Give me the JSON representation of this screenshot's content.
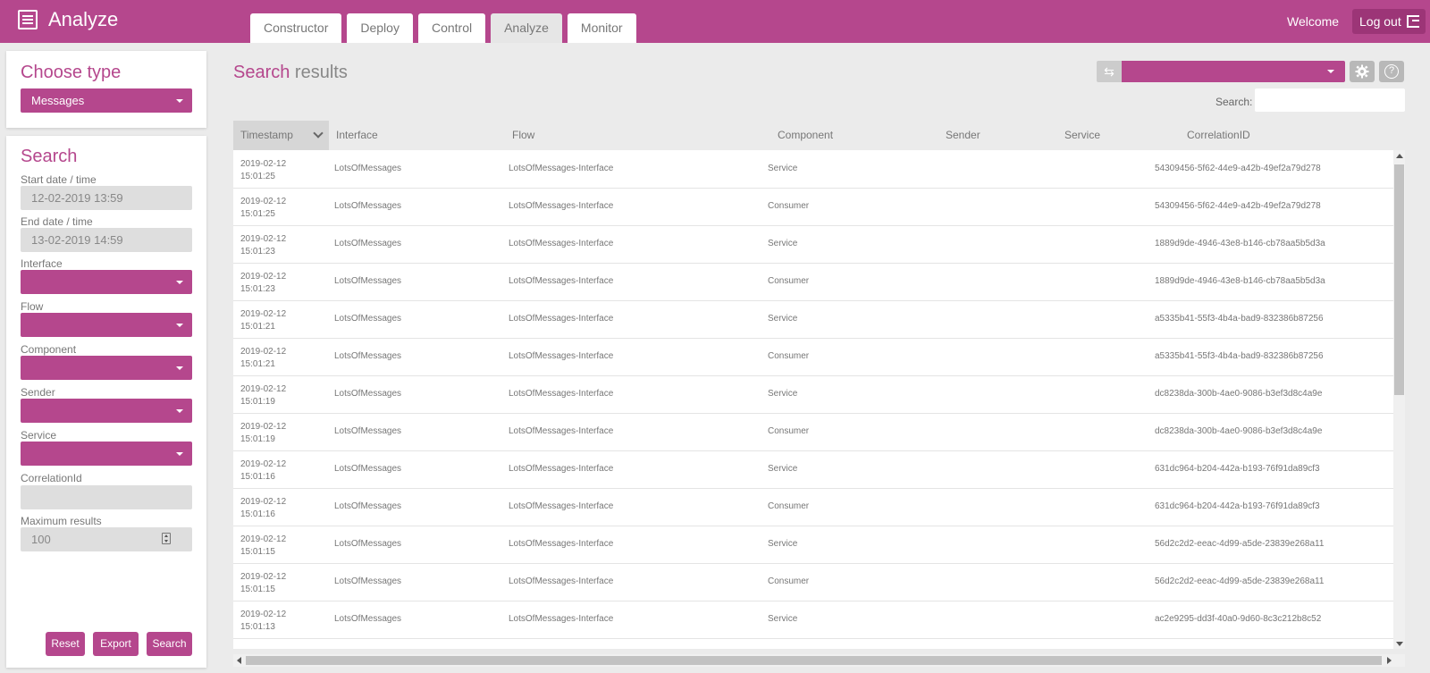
{
  "app": {
    "title": "Analyze",
    "welcome": "Welcome",
    "logout_label": "Log out"
  },
  "tabs": [
    {
      "label": "Constructor",
      "active": false
    },
    {
      "label": "Deploy",
      "active": false
    },
    {
      "label": "Control",
      "active": false
    },
    {
      "label": "Analyze",
      "active": true
    },
    {
      "label": "Monitor",
      "active": false
    }
  ],
  "choose_type": {
    "title": "Choose type",
    "selected": "Messages"
  },
  "search_panel": {
    "title": "Search",
    "start_label": "Start date / time",
    "start_value": "12-02-2019 13:59",
    "end_label": "End date / time",
    "end_value": "13-02-2019 14:59",
    "interface_label": "Interface",
    "flow_label": "Flow",
    "component_label": "Component",
    "sender_label": "Sender",
    "service_label": "Service",
    "correlation_label": "CorrelationId",
    "correlation_value": "",
    "max_label": "Maximum results",
    "max_value": "100",
    "reset_label": "Reset",
    "export_label": "Export",
    "search_label": "Search"
  },
  "results": {
    "title_accent": "Search",
    "title_rest": " results",
    "search_label": "Search:",
    "search_value": ""
  },
  "table": {
    "columns": [
      "Timestamp",
      "Interface",
      "Flow",
      "Component",
      "Sender",
      "Service",
      "CorrelationID"
    ],
    "rows": [
      {
        "date": "2019-02-12",
        "time": "15:01:25",
        "interface": "LotsOfMessages",
        "flow": "LotsOfMessages-Interface",
        "component": "Service",
        "sender": "",
        "service": "",
        "correlation": "54309456-5f62-44e9-a42b-49ef2a79d278"
      },
      {
        "date": "2019-02-12",
        "time": "15:01:25",
        "interface": "LotsOfMessages",
        "flow": "LotsOfMessages-Interface",
        "component": "Consumer",
        "sender": "",
        "service": "",
        "correlation": "54309456-5f62-44e9-a42b-49ef2a79d278"
      },
      {
        "date": "2019-02-12",
        "time": "15:01:23",
        "interface": "LotsOfMessages",
        "flow": "LotsOfMessages-Interface",
        "component": "Service",
        "sender": "",
        "service": "",
        "correlation": "1889d9de-4946-43e8-b146-cb78aa5b5d3a"
      },
      {
        "date": "2019-02-12",
        "time": "15:01:23",
        "interface": "LotsOfMessages",
        "flow": "LotsOfMessages-Interface",
        "component": "Consumer",
        "sender": "",
        "service": "",
        "correlation": "1889d9de-4946-43e8-b146-cb78aa5b5d3a"
      },
      {
        "date": "2019-02-12",
        "time": "15:01:21",
        "interface": "LotsOfMessages",
        "flow": "LotsOfMessages-Interface",
        "component": "Service",
        "sender": "",
        "service": "",
        "correlation": "a5335b41-55f3-4b4a-bad9-832386b87256"
      },
      {
        "date": "2019-02-12",
        "time": "15:01:21",
        "interface": "LotsOfMessages",
        "flow": "LotsOfMessages-Interface",
        "component": "Consumer",
        "sender": "",
        "service": "",
        "correlation": "a5335b41-55f3-4b4a-bad9-832386b87256"
      },
      {
        "date": "2019-02-12",
        "time": "15:01:19",
        "interface": "LotsOfMessages",
        "flow": "LotsOfMessages-Interface",
        "component": "Service",
        "sender": "",
        "service": "",
        "correlation": "dc8238da-300b-4ae0-9086-b3ef3d8c4a9e"
      },
      {
        "date": "2019-02-12",
        "time": "15:01:19",
        "interface": "LotsOfMessages",
        "flow": "LotsOfMessages-Interface",
        "component": "Consumer",
        "sender": "",
        "service": "",
        "correlation": "dc8238da-300b-4ae0-9086-b3ef3d8c4a9e"
      },
      {
        "date": "2019-02-12",
        "time": "15:01:16",
        "interface": "LotsOfMessages",
        "flow": "LotsOfMessages-Interface",
        "component": "Service",
        "sender": "",
        "service": "",
        "correlation": "631dc964-b204-442a-b193-76f91da89cf3"
      },
      {
        "date": "2019-02-12",
        "time": "15:01:16",
        "interface": "LotsOfMessages",
        "flow": "LotsOfMessages-Interface",
        "component": "Consumer",
        "sender": "",
        "service": "",
        "correlation": "631dc964-b204-442a-b193-76f91da89cf3"
      },
      {
        "date": "2019-02-12",
        "time": "15:01:15",
        "interface": "LotsOfMessages",
        "flow": "LotsOfMessages-Interface",
        "component": "Service",
        "sender": "",
        "service": "",
        "correlation": "56d2c2d2-eeac-4d99-a5de-23839e268a11"
      },
      {
        "date": "2019-02-12",
        "time": "15:01:15",
        "interface": "LotsOfMessages",
        "flow": "LotsOfMessages-Interface",
        "component": "Consumer",
        "sender": "",
        "service": "",
        "correlation": "56d2c2d2-eeac-4d99-a5de-23839e268a11"
      },
      {
        "date": "2019-02-12",
        "time": "15:01:13",
        "interface": "LotsOfMessages",
        "flow": "LotsOfMessages-Interface",
        "component": "Service",
        "sender": "",
        "service": "",
        "correlation": "ac2e9295-dd3f-40a0-9d60-8c3c212b8c52"
      }
    ]
  },
  "colors": {
    "accent": "#b5478d",
    "accent_dark": "#9c3577",
    "background": "#ebebeb"
  }
}
